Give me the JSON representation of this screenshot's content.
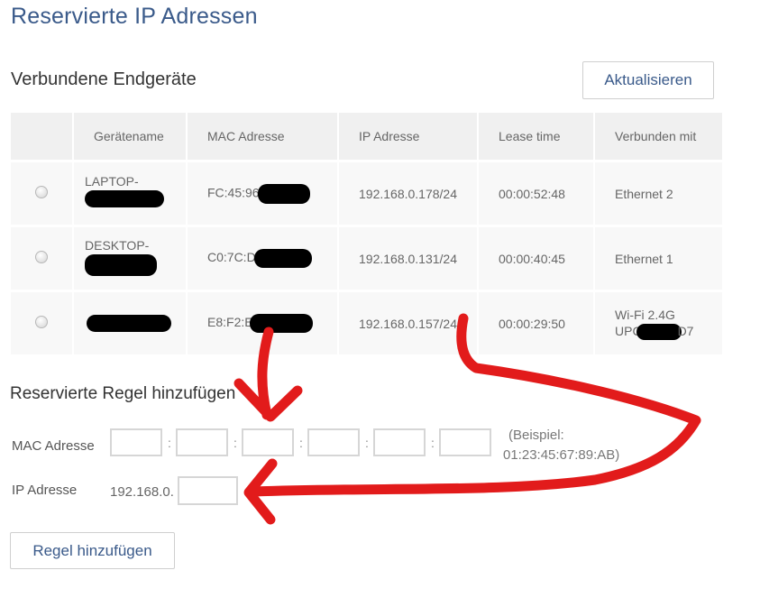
{
  "page": {
    "title": "Reservierte IP Adressen"
  },
  "devices_section": {
    "title": "Verbundene Endgeräte",
    "refresh_label": "Aktualisieren",
    "columns": [
      "",
      "Gerätename",
      "MAC Adresse",
      "IP Adresse",
      "Lease time",
      "Verbunden mit"
    ],
    "rows": [
      {
        "name": "LAPTOP-",
        "mac": "FC:45:96",
        "ip": "192.168.0.178/24",
        "lease": "00:00:52:48",
        "connected": "Ethernet 2"
      },
      {
        "name": "DESKTOP-",
        "mac": "C0:7C:D",
        "ip": "192.168.0.131/24",
        "lease": "00:00:40:45",
        "connected": "Ethernet 1"
      },
      {
        "name": "",
        "mac": "E8:F2:E",
        "ip": "192.168.0.157/24",
        "lease": "00:00:29:50",
        "connected_line1": "Wi-Fi 2.4G",
        "connected_line2_start": "UPC",
        "connected_line2_end": "D7"
      }
    ]
  },
  "add_rule": {
    "title": "Reservierte Regel hinzufügen",
    "mac_label": "MAC Adresse",
    "mac_separator": ":",
    "example_line1": "(Beispiel:",
    "example_line2": "01:23:45:67:89:AB)",
    "ip_label": "IP Adresse",
    "ip_prefix": "192.168.0.",
    "submit_label": "Regel hinzufügen"
  },
  "colors": {
    "title_blue": "#3a5a8a",
    "annotation_red": "#e21b1b",
    "redaction": "#000000"
  }
}
